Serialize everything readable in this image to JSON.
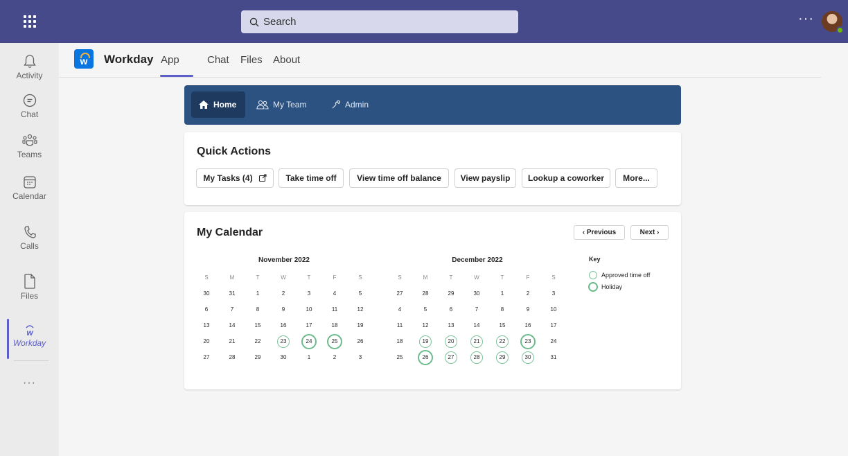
{
  "topbar": {
    "search_placeholder": "Search",
    "more": "···"
  },
  "rail": [
    {
      "label": "Activity",
      "icon": "bell-icon"
    },
    {
      "label": "Chat",
      "icon": "chat-icon"
    },
    {
      "label": "Teams",
      "icon": "teams-icon"
    },
    {
      "label": "Calendar",
      "icon": "calendar-icon"
    },
    {
      "label": "Calls",
      "icon": "phone-icon"
    },
    {
      "label": "Files",
      "icon": "file-icon"
    },
    {
      "label": "Workday",
      "icon": "workday-icon"
    }
  ],
  "rail_more": "···",
  "app": {
    "logo_letter": "w",
    "title": "Workday",
    "tabs": [
      "App",
      "Chat",
      "Files",
      "About"
    ],
    "active_tab": "App"
  },
  "nav": {
    "home": "Home",
    "team": "My Team",
    "admin": "Admin"
  },
  "quick_actions": {
    "title": "Quick Actions",
    "buttons": [
      "My Tasks (4)",
      "Take time off",
      "View time off balance",
      "View payslip",
      "Lookup a coworker",
      "More..."
    ]
  },
  "calendar": {
    "title": "My Calendar",
    "prev": "‹  Previous",
    "next": "Next  ›",
    "weekdays": [
      "S",
      "M",
      "T",
      "W",
      "T",
      "F",
      "S"
    ],
    "months": [
      {
        "name": "November 2022",
        "weeks": [
          [
            "30",
            "31",
            "1",
            "2",
            "3",
            "4",
            "5"
          ],
          [
            "6",
            "7",
            "8",
            "9",
            "10",
            "11",
            "12"
          ],
          [
            "13",
            "14",
            "15",
            "16",
            "17",
            "18",
            "19"
          ],
          [
            "20",
            "21",
            "22",
            "23",
            "24",
            "25",
            "26"
          ],
          [
            "27",
            "28",
            "29",
            "30",
            "1",
            "2",
            "3"
          ]
        ],
        "approved": [
          "23"
        ],
        "holiday": [
          "24",
          "25"
        ]
      },
      {
        "name": "December 2022",
        "weeks": [
          [
            "27",
            "28",
            "29",
            "30",
            "1",
            "2",
            "3"
          ],
          [
            "4",
            "5",
            "6",
            "7",
            "8",
            "9",
            "10"
          ],
          [
            "11",
            "12",
            "13",
            "14",
            "15",
            "16",
            "17"
          ],
          [
            "18",
            "19",
            "20",
            "21",
            "22",
            "23",
            "24"
          ],
          [
            "25",
            "26",
            "27",
            "28",
            "29",
            "30",
            "31"
          ]
        ],
        "approved": [
          "19",
          "20",
          "21",
          "22",
          "27",
          "28",
          "29",
          "30"
        ],
        "holiday": [
          "23",
          "26"
        ]
      }
    ],
    "key": {
      "title": "Key",
      "approved": "Approved time off",
      "holiday": "Holiday"
    },
    "colors": {
      "approved": "#7cc49a",
      "holiday": "#6dbb8d"
    }
  },
  "colors": {
    "topbar": "#474a8a",
    "nav": "#2c5282",
    "accent": "#5b5fc7"
  }
}
